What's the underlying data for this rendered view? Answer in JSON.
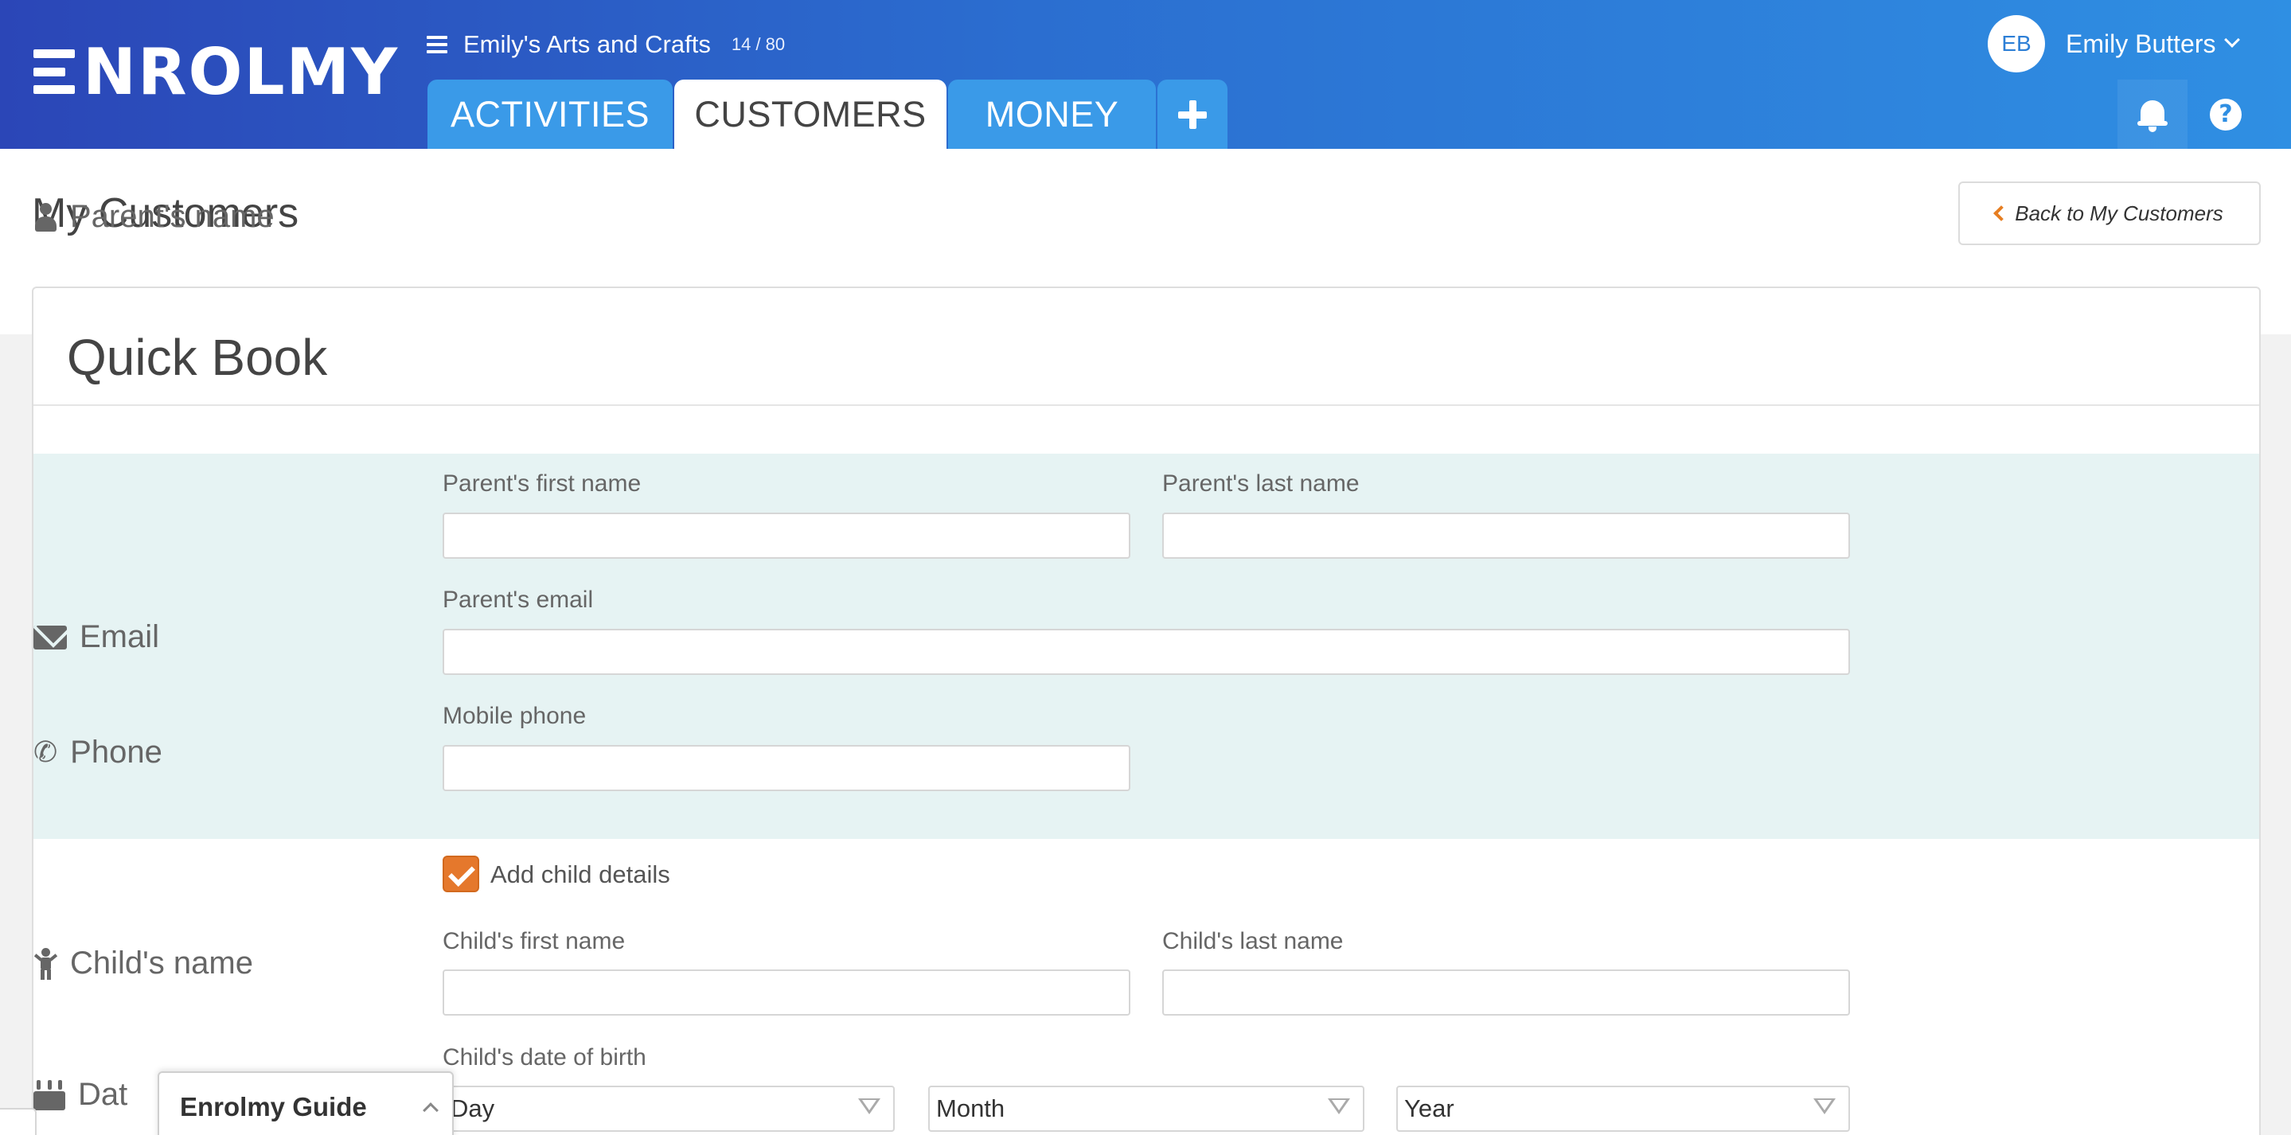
{
  "header": {
    "logo_text": "NROLMY",
    "org_name": "Emily's Arts and Crafts",
    "org_count": "14 / 80",
    "tabs": [
      {
        "label": "ACTIVITIES"
      },
      {
        "label": "CUSTOMERS"
      },
      {
        "label": "MONEY"
      }
    ],
    "active_tab": "CUSTOMERS",
    "user": {
      "initials": "EB",
      "name": "Emily Butters"
    },
    "help_glyph": "?"
  },
  "page": {
    "title": "My Customers",
    "back_button": "Back to My Customers"
  },
  "form": {
    "title": "Quick Book",
    "parent_label": "Parent's name",
    "parent_first_caption": "Parent's first name",
    "parent_last_caption": "Parent's last name",
    "email_label": "Email",
    "email_caption": "Parent's email",
    "phone_label": "Phone",
    "phone_caption": "Mobile phone",
    "add_child_label": "Add child details",
    "add_child_checked": true,
    "child_label": "Child's name",
    "child_first_caption": "Child's first name",
    "child_last_caption": "Child's last name",
    "dob_label": "Dat",
    "dob_caption": "Child's date of birth",
    "day_select": "Day",
    "month_select": "Month",
    "year_select": "Year"
  },
  "guide": {
    "label": "Enrolmy Guide"
  },
  "colors": {
    "header_start": "#2b46b7",
    "header_end": "#2f8fe3",
    "tab_inactive": "#3a9ae8",
    "panel": "#e6f3f3",
    "checkbox": "#e5782c",
    "back_chevron": "#e67e22"
  },
  "icons": {
    "menu": "hamburger-icon",
    "add": "plus-icon",
    "notifications": "bell-icon",
    "help": "question-icon",
    "parent": "user-icon",
    "email": "envelope-icon",
    "phone": "phone-icon",
    "child": "child-icon",
    "dob": "birthday-cake-icon"
  }
}
